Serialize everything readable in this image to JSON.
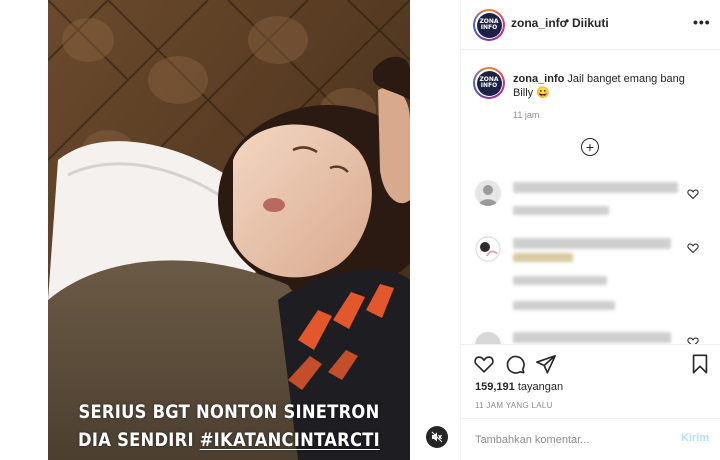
{
  "header": {
    "username": "zona_info",
    "separator": "•",
    "follow_status": "Diikuti",
    "more_label": "•••",
    "avatar_text_top": "ZONA",
    "avatar_text_bottom": "INFO"
  },
  "media": {
    "caption_line1": "SERIUS BGT NONTON SINETRON",
    "caption_line2_prefix": "DIA SENDIRI ",
    "caption_line2_tag": "#IKATANCINTARCTI",
    "mute_icon": "speaker-muted-icon"
  },
  "post": {
    "username": "zona_info",
    "caption": "Jail banget emang bang Billy 😀",
    "time": "11 jam",
    "load_more_icon": "plus-circle-icon"
  },
  "actions": {
    "like_icon": "heart-icon",
    "comment_icon": "comment-bubble-icon",
    "share_icon": "paper-plane-icon",
    "save_icon": "bookmark-icon",
    "views_count": "159,191",
    "views_label": "tayangan",
    "posted_ago": "11 JAM YANG LALU"
  },
  "comment_box": {
    "placeholder": "Tambahkan komentar...",
    "send_label": "Kirim"
  },
  "colors": {
    "text": "#262626",
    "muted": "#8e8e8e",
    "border": "#efefef",
    "send_disabled": "#b2dffc"
  }
}
